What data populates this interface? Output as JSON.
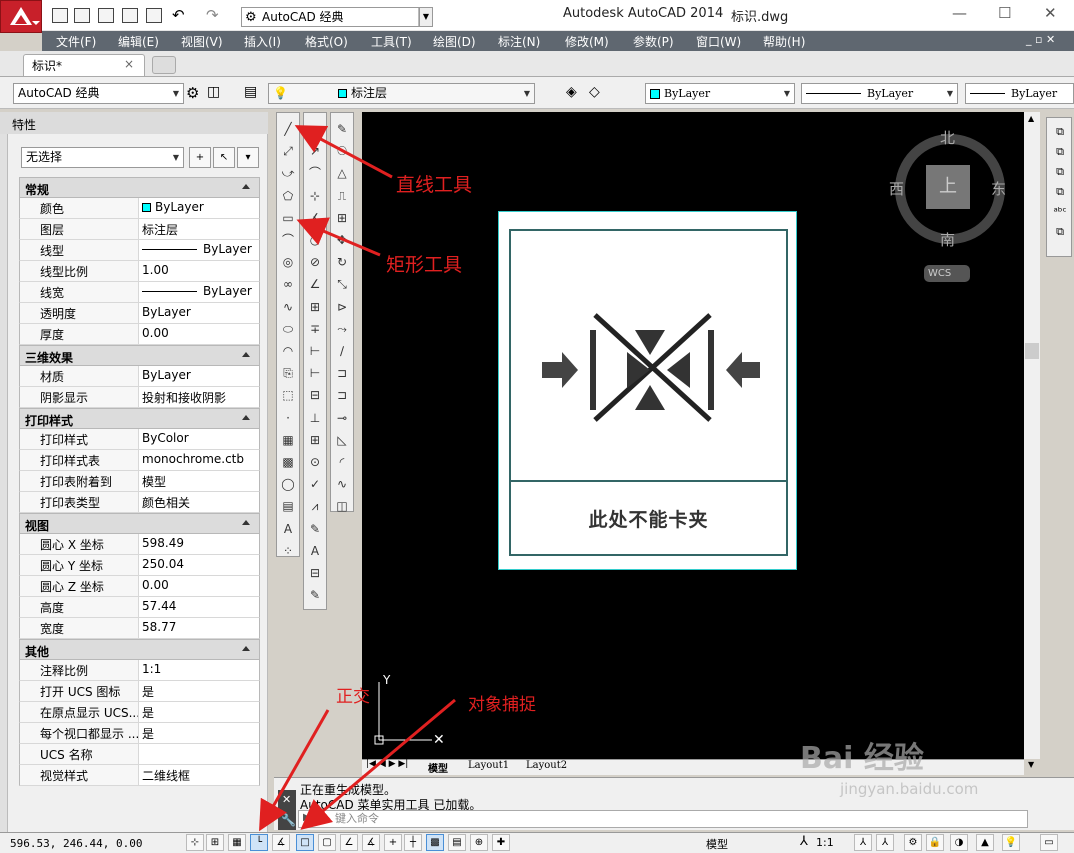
{
  "titlebar": {
    "workspace": "AutoCAD 经典",
    "app_title": "Autodesk AutoCAD 2014",
    "file_name": "标识.dwg",
    "min": "—",
    "max": "☐",
    "close": "✕"
  },
  "menu": [
    "文件(F)",
    "编辑(E)",
    "视图(V)",
    "插入(I)",
    "格式(O)",
    "工具(T)",
    "绘图(D)",
    "标注(N)",
    "修改(M)",
    "参数(P)",
    "窗口(W)",
    "帮助(H)"
  ],
  "tab": {
    "label": "标识*",
    "close": "×"
  },
  "toolbar": {
    "workspace": "AutoCAD 经典",
    "layer": "标注层",
    "color": "ByLayer",
    "linetype": "ByLayer",
    "lineweight": "ByLayer"
  },
  "properties": {
    "title": "特性",
    "selection": "无选择",
    "sections": [
      {
        "name": "常规",
        "rows": [
          [
            "颜色",
            "ByLayer"
          ],
          [
            "图层",
            "标注层"
          ],
          [
            "线型",
            "ByLayer"
          ],
          [
            "线型比例",
            "1.00"
          ],
          [
            "线宽",
            "ByLayer"
          ],
          [
            "透明度",
            "ByLayer"
          ],
          [
            "厚度",
            "0.00"
          ]
        ]
      },
      {
        "name": "三维效果",
        "rows": [
          [
            "材质",
            "ByLayer"
          ],
          [
            "阴影显示",
            "投射和接收阴影"
          ]
        ]
      },
      {
        "name": "打印样式",
        "rows": [
          [
            "打印样式",
            "ByColor"
          ],
          [
            "打印样式表",
            "monochrome.ctb"
          ],
          [
            "打印表附着到",
            "模型"
          ],
          [
            "打印表类型",
            "颜色相关"
          ]
        ]
      },
      {
        "name": "视图",
        "rows": [
          [
            "圆心 X 坐标",
            "598.49"
          ],
          [
            "圆心 Y 坐标",
            "250.04"
          ],
          [
            "圆心 Z 坐标",
            "0.00"
          ],
          [
            "高度",
            "57.44"
          ],
          [
            "宽度",
            "58.77"
          ]
        ]
      },
      {
        "name": "其他",
        "rows": [
          [
            "注释比例",
            "1:1"
          ],
          [
            "打开 UCS 图标",
            "是"
          ],
          [
            "在原点显示 UCS...",
            "是"
          ],
          [
            "每个视口都显示 ...",
            "是"
          ],
          [
            "UCS 名称",
            ""
          ],
          [
            "视觉样式",
            "二维线框"
          ]
        ]
      }
    ]
  },
  "viewcube": {
    "n": "北",
    "s": "南",
    "w": "西",
    "e": "东",
    "top": "上",
    "wcs": "WCS"
  },
  "drawing": {
    "sign_text": "此处不能卡夹"
  },
  "annotations": {
    "line_tool": "直线工具",
    "rect_tool": "矩形工具",
    "ortho": "正交",
    "osnap": "对象捕捉"
  },
  "layout_tabs": [
    "模型",
    "Layout1",
    "Layout2"
  ],
  "command": {
    "line1": "正在重生成模型。",
    "line2": "AutoCAD 菜单实用工具 已加载。",
    "placeholder": "键入命令"
  },
  "status": {
    "coords": "596.53, 246.44, 0.00",
    "model": "模型",
    "scale": "1:1"
  },
  "watermark": {
    "text": "Bai 经验",
    "url": "jingyan.baidu.com"
  }
}
